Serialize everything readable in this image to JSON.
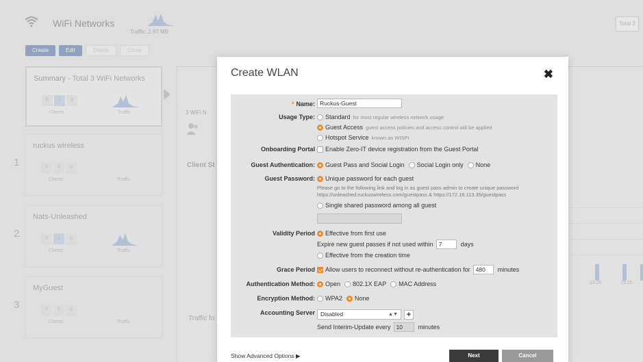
{
  "app": {
    "title": "WiFi Networks",
    "traffic_caption": "Traffic: 2.97 MB",
    "total_button": "Total 3",
    "actions": {
      "create": "Create",
      "edit": "Edit",
      "delete": "Delete",
      "clone": "Clone"
    },
    "summary": {
      "title": "Summary",
      "subtitle": " - Total 3 WiFi Networks",
      "mini_values": [
        "0",
        "1",
        "0"
      ],
      "clients_label": "Clients",
      "traffic_label": "Traffic"
    },
    "networks": [
      {
        "index": "1",
        "name": "ruckus wireless",
        "mini_values": [
          "0",
          "0",
          "0"
        ],
        "clients_label": "Clients",
        "traffic_label": "Traffic"
      },
      {
        "index": "2",
        "name": "Nats-Unleashed",
        "mini_values": [
          "0",
          "1",
          "0"
        ],
        "clients_label": "Clients",
        "traffic_label": "Traffic"
      },
      {
        "index": "3",
        "name": "MyGuest",
        "mini_values": [
          "0",
          "0",
          "0"
        ],
        "clients_label": "Clients",
        "traffic_label": "Traffic"
      }
    ],
    "right_panel": {
      "wifi_count_label": "3 WiFi N",
      "client_stats_label": "Client St",
      "traffic_label": "Traffic fo",
      "times": [
        "15:20",
        "15:25"
      ]
    }
  },
  "modal": {
    "title": "Create WLAN",
    "name": {
      "label": "Name:",
      "value": "Ruckus-Guest"
    },
    "usage_type": {
      "label": "Usage Type:",
      "options": [
        {
          "label": "Standard",
          "hint": "for most regular wireless network usage",
          "selected": false
        },
        {
          "label": "Guest Access",
          "hint": "guest access policies and access control will be applied",
          "selected": true
        },
        {
          "label": "Hotspot Service",
          "hint": "known as WISPr",
          "selected": false
        }
      ]
    },
    "onboarding_portal": {
      "label": "Onboarding Portal",
      "option": "Enable Zero-IT device registration from the Guest Portal",
      "checked": false
    },
    "guest_authentication": {
      "label": "Guest Authentication:",
      "options": [
        {
          "label": "Guest Pass and Social Login",
          "selected": true
        },
        {
          "label": "Social Login only",
          "selected": false
        },
        {
          "label": "None",
          "selected": false
        }
      ]
    },
    "guest_password": {
      "label": "Guest Password:",
      "unique_option": "Unique password for each guest",
      "info_line1": "Please go to the following link and log in as guest pass admin to create unique password",
      "info_line2": "https://unleashed.ruckuswireless.com/guestpass & https://172.16.113.35/guestpass",
      "shared_option": "Single shared password among all guest",
      "shared_value": ""
    },
    "validity_period": {
      "label": "Validity Period",
      "first_use_option": "Effective from first use",
      "expire_prefix": "Expire new guest passes if not used within",
      "expire_value": "7",
      "expire_unit": "days",
      "creation_option": "Effective from the creation time"
    },
    "grace_period": {
      "label": "Grace Period",
      "option_text": "Allow users to reconnect without re-authentication for",
      "value": "480",
      "unit": "minutes",
      "checked": true
    },
    "authentication_method": {
      "label": "Authentication Method:",
      "options": [
        {
          "label": "Open",
          "selected": true
        },
        {
          "label": "802.1X EAP",
          "selected": false
        },
        {
          "label": "MAC Address",
          "selected": false
        }
      ]
    },
    "encryption_method": {
      "label": "Encryption Method:",
      "options": [
        {
          "label": "WPA2",
          "selected": false
        },
        {
          "label": "None",
          "selected": true
        }
      ]
    },
    "accounting_server": {
      "label": "Accounting Server",
      "selected": "Disabled",
      "plus": "+",
      "interim_prefix": "Send Interim-Update every",
      "interim_value": "10",
      "interim_unit": "minutes"
    },
    "advanced_options": "Show Advanced Options ▶",
    "next_button": "Next",
    "cancel_button": "Cancel",
    "close_symbol": "✖"
  },
  "colors": {
    "accent": "#f08a24",
    "action_blue": "#7a93b9",
    "dark_button": "#3a3a3a"
  }
}
